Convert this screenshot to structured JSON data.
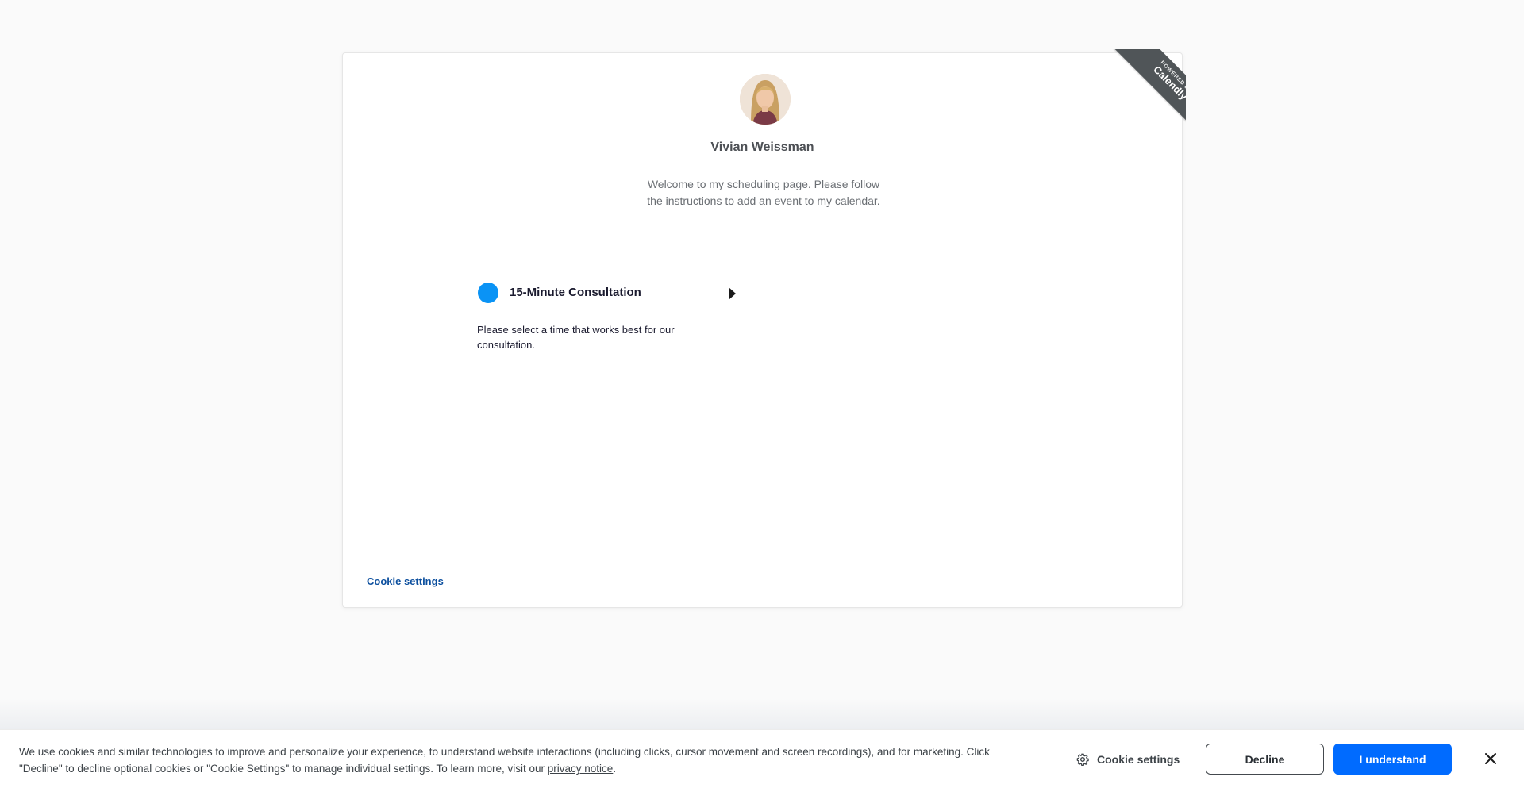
{
  "ribbon": {
    "powered_by": "Powered by",
    "brand": "Calendly"
  },
  "host": {
    "name": "Vivian Weissman",
    "welcome": "Welcome to my scheduling page. Please follow the instructions to add an event to my calendar."
  },
  "event": {
    "title": "15-Minute Consultation",
    "description": "Please select a time that works best for our consultation.",
    "color": "#0a93f5"
  },
  "card_footer": {
    "cookie_settings": "Cookie settings"
  },
  "cookie_banner": {
    "text_before_link": "We use cookies and similar technologies to improve and personalize your experience, to understand website interactions (including clicks, cursor movement and screen recordings), and for marketing. Click \"Decline\" to decline optional cookies or \"Cookie Settings\" to manage individual settings. To learn more, visit our ",
    "link_text": "privacy notice",
    "text_after_link": ".",
    "settings_label": "Cookie settings",
    "decline_label": "Decline",
    "accept_label": "I understand",
    "accent_color": "#006bff"
  },
  "icons": {
    "settings": "gear-icon",
    "close": "close-icon",
    "arrow": "caret-right-icon"
  }
}
